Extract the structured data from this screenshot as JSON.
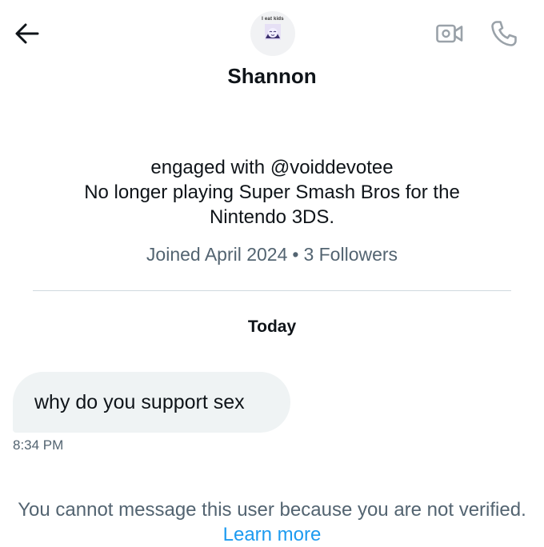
{
  "header": {
    "back_icon": "arrow-left-icon",
    "video_icon": "video-call-icon",
    "call_icon": "phone-icon",
    "avatar_caption": "I eat kids",
    "name": "Shannon"
  },
  "profile": {
    "bio_lines": [
      "engaged with @voiddevotee",
      "No longer playing Super Smash Bros for the",
      "Nintendo 3DS."
    ],
    "joined": "Joined April 2024",
    "separator": "•",
    "followers": "3 Followers"
  },
  "conversation": {
    "date_label": "Today",
    "messages": [
      {
        "text": "why do you support sex",
        "time": "8:34 PM"
      }
    ]
  },
  "footer": {
    "notice": "You cannot message this user because you are not verified.",
    "link_label": "Learn more"
  },
  "colors": {
    "text": "#0f1419",
    "secondary": "#536471",
    "link": "#1d9bf0",
    "bubble": "#eff3f4",
    "divider": "#cfd9de"
  }
}
